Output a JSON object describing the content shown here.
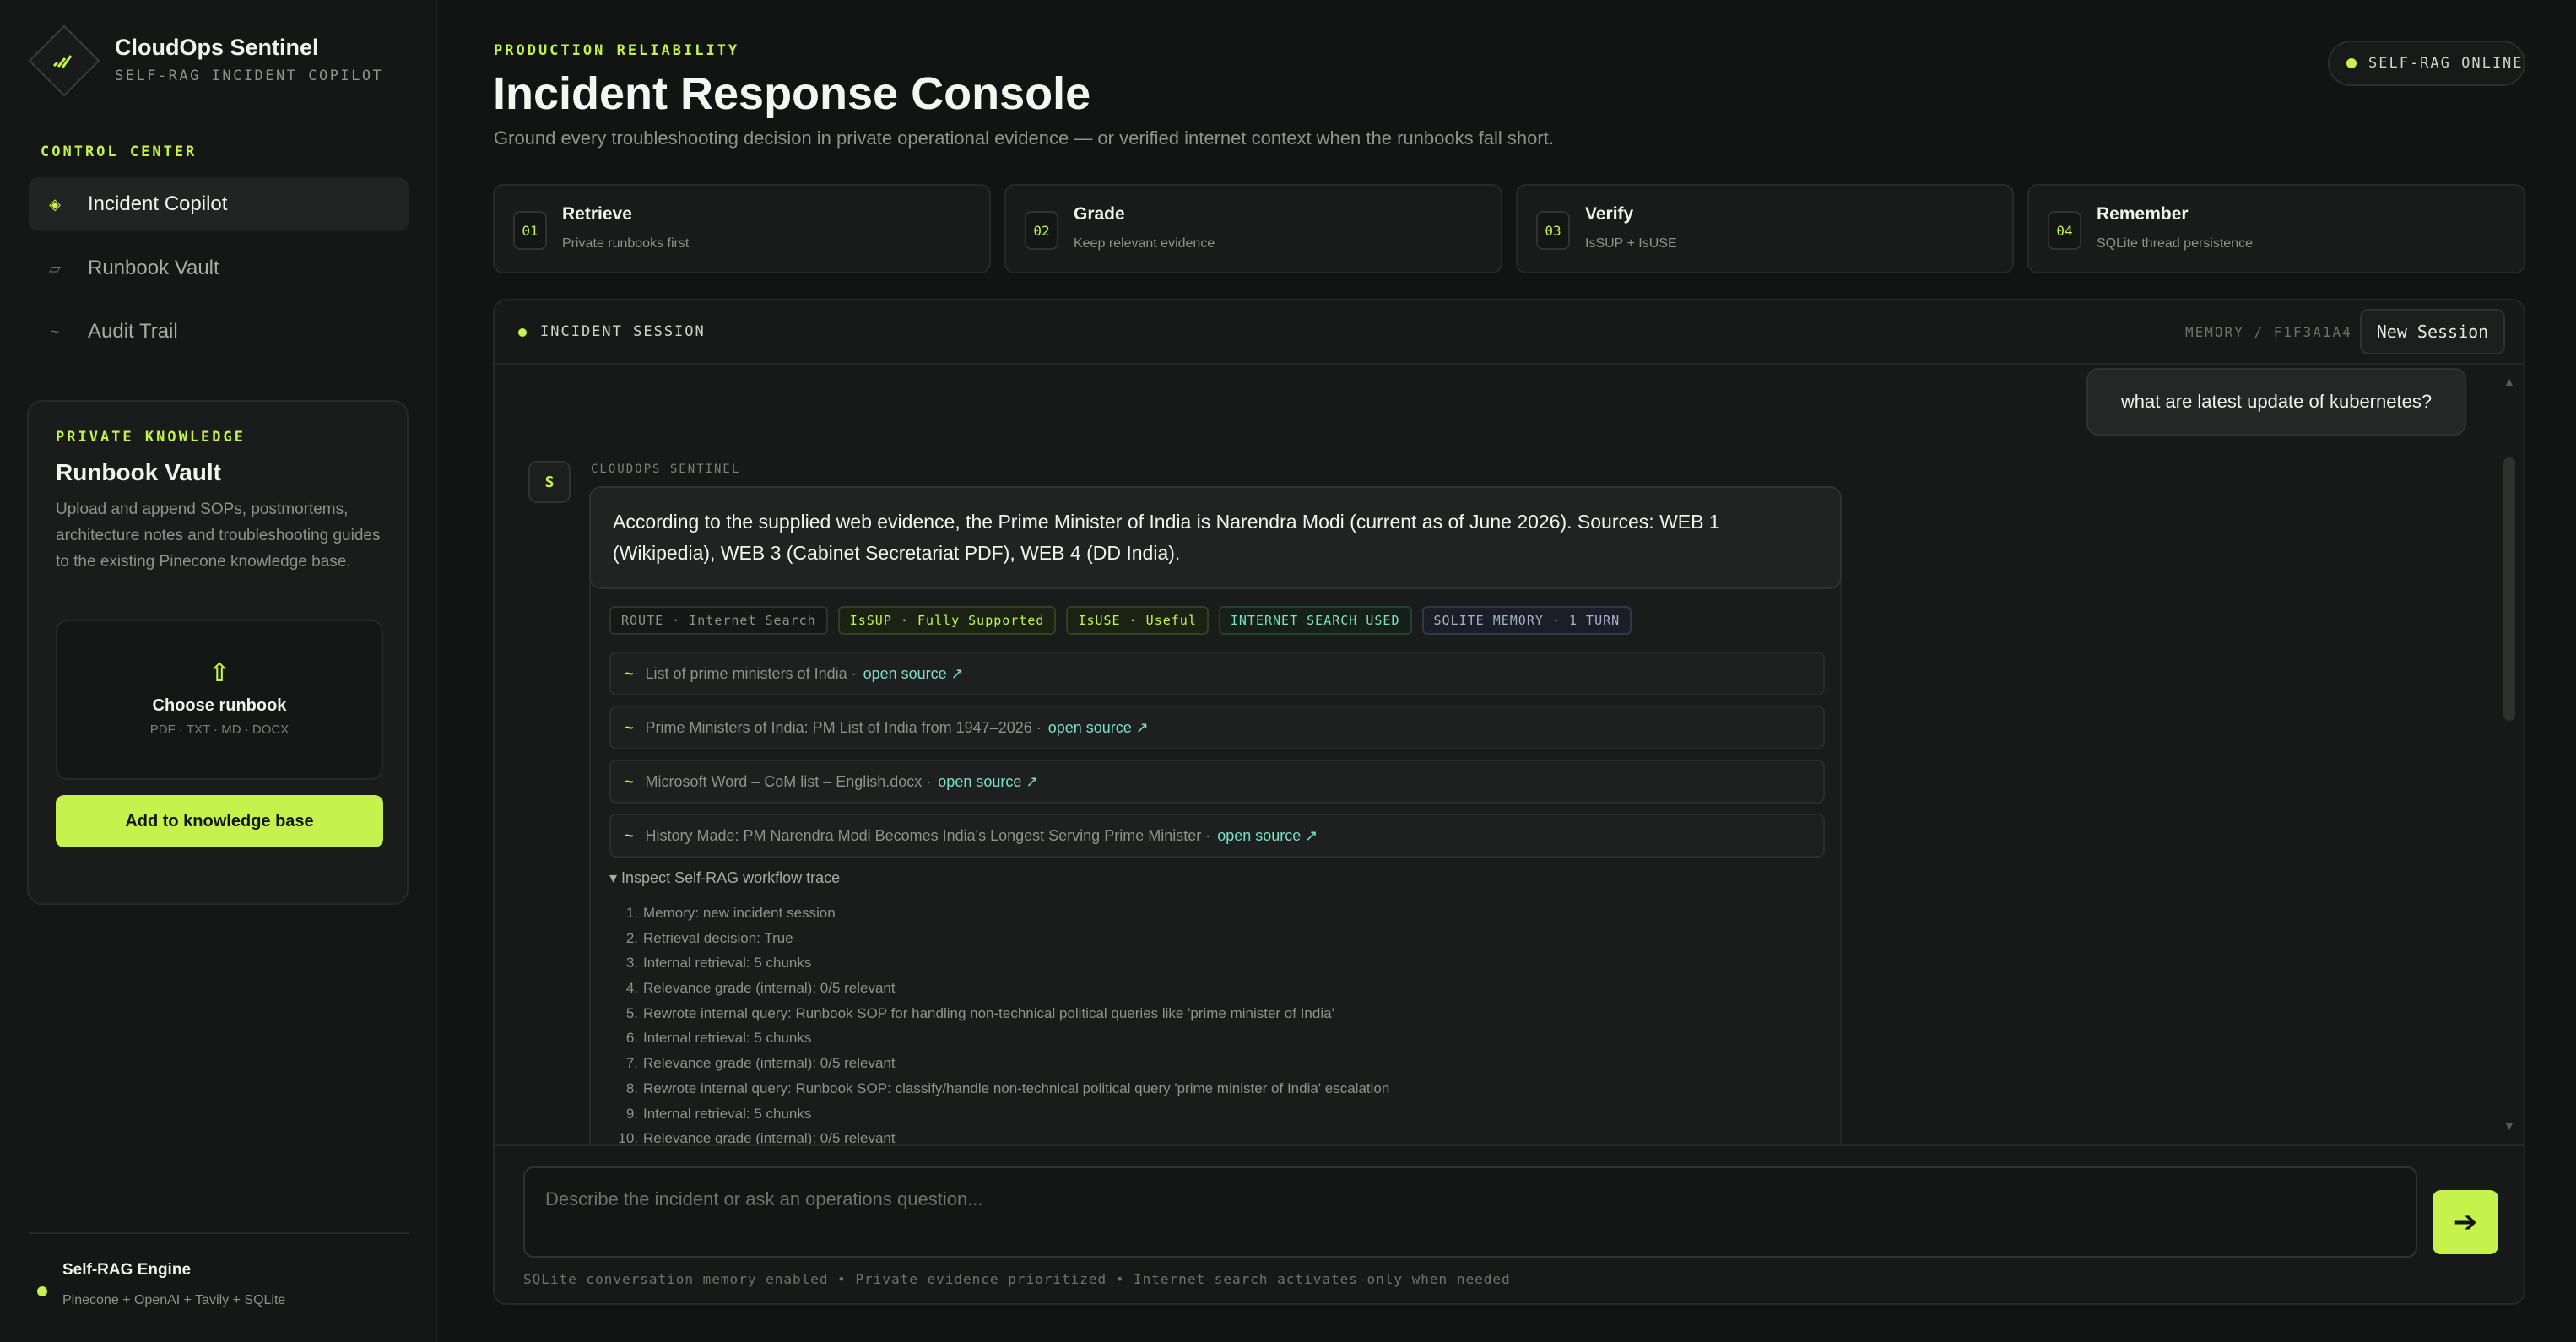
{
  "brand": {
    "name": "CloudOps Sentinel",
    "subtitle": "SELF-RAG INCIDENT COPILOT"
  },
  "nav": {
    "section_label": "CONTROL CENTER",
    "items": [
      {
        "label": "Incident Copilot",
        "icon": "diamond-icon",
        "active": true
      },
      {
        "label": "Runbook Vault",
        "icon": "folder-icon",
        "active": false
      },
      {
        "label": "Audit Trail",
        "icon": "trail-icon",
        "active": false
      }
    ]
  },
  "vault": {
    "section_label": "PRIVATE KNOWLEDGE",
    "title": "Runbook Vault",
    "description": "Upload and append SOPs, postmortems, architecture notes and troubleshooting guides to the existing Pinecone knowledge base.",
    "choose_label": "Choose runbook",
    "file_types": "PDF · TXT · MD · DOCX",
    "add_button": "Add to knowledge base"
  },
  "engine": {
    "title": "Self-RAG Engine",
    "stack": "Pinecone + OpenAI + Tavily + SQLite"
  },
  "header": {
    "eyebrow": "PRODUCTION RELIABILITY",
    "title": "Incident Response Console",
    "subtitle": "Ground every troubleshooting decision in private operational evidence — or verified internet context when the runbooks fall short.",
    "status": "SELF-RAG ONLINE"
  },
  "steps": [
    {
      "num": "01",
      "title": "Retrieve",
      "sub": "Private runbooks first"
    },
    {
      "num": "02",
      "title": "Grade",
      "sub": "Keep relevant evidence"
    },
    {
      "num": "03",
      "title": "Verify",
      "sub": "IsSUP + IsUSE"
    },
    {
      "num": "04",
      "title": "Remember",
      "sub": "SQLite thread persistence"
    }
  ],
  "session": {
    "label": "INCIDENT SESSION",
    "memory_id": "MEMORY / F1F3A1A4",
    "new_session": "New Session",
    "user_message": "what are latest update of kubernetes?",
    "assistant_name": "CLOUDOPS SENTINEL",
    "avatar": "S",
    "answer": "According to the supplied web evidence, the Prime Minister of India is Narendra Modi (current as of June 2026). Sources: WEB 1 (Wikipedia), WEB 3 (Cabinet Secretariat PDF), WEB 4 (DD India).",
    "tags": {
      "route": "ROUTE · Internet Search",
      "issup": "IsSUP · Fully Supported",
      "isuse": "IsUSE · Useful",
      "internet": "INTERNET SEARCH USED",
      "memory": "SQLITE MEMORY · 1 TURN"
    },
    "sources": [
      {
        "title": "List of prime ministers of India ·",
        "link": "open source ↗"
      },
      {
        "title": "Prime Ministers of India: PM List of India from 1947–2026 ·",
        "link": "open source ↗"
      },
      {
        "title": "Microsoft Word – CoM list – English.docx ·",
        "link": "open source ↗"
      },
      {
        "title": "History Made: PM Narendra Modi Becomes India's Longest Serving Prime Minister ·",
        "link": "open source ↗"
      }
    ],
    "trace_toggle": "▾ Inspect Self-RAG workflow trace",
    "trace": [
      "Memory: new incident session",
      "Retrieval decision: True",
      "Internal retrieval: 5 chunks",
      "Relevance grade (internal): 0/5 relevant",
      "Rewrote internal query: Runbook SOP for handling non-technical political queries like 'prime minister of India'",
      "Internal retrieval: 5 chunks",
      "Relevance grade (internal): 0/5 relevant",
      "Rewrote internal query: Runbook SOP: classify/handle non-technical political query 'prime minister of India' escalation",
      "Internal retrieval: 5 chunks",
      "Relevance grade (internal): 0/5 relevant"
    ],
    "trace_numbers": [
      "1.",
      "2.",
      "3.",
      "4.",
      "5.",
      "6.",
      "7.",
      "8.",
      "9.",
      "10."
    ]
  },
  "composer": {
    "placeholder": "Describe the incident or ask an operations question...",
    "send_icon": "arrow-right-icon",
    "hint": "SQLite conversation memory enabled  •  Private evidence prioritized  •  Internet search activates only when needed"
  },
  "colors": {
    "accent": "#c6f24e",
    "link": "#7de0c6",
    "background": "#121413"
  }
}
